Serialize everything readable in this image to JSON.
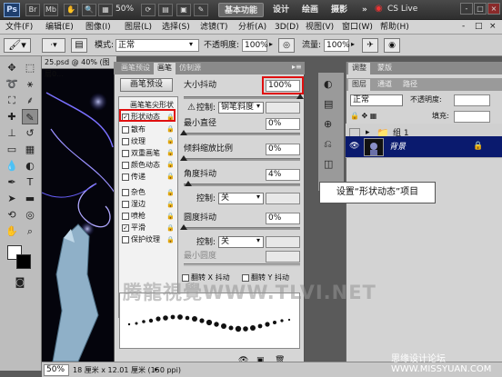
{
  "topbar": {
    "logo": "Ps",
    "zoom": "50%",
    "workspaces": [
      "基本功能",
      "设计",
      "绘画",
      "摄影"
    ],
    "more": "»",
    "cslive": "CS Live",
    "win_controls": [
      "-",
      "□",
      "×"
    ]
  },
  "menubar": {
    "items": [
      "文件(F)",
      "编辑(E)",
      "图像(I)",
      "图层(L)",
      "选择(S)",
      "滤镜(T)",
      "分析(A)",
      "3D(D)",
      "视图(V)",
      "窗口(W)",
      "帮助(H)"
    ],
    "win_controls": [
      "-",
      "□",
      "×"
    ]
  },
  "options_bar": {
    "mode_label": "模式:",
    "mode_value": "正常",
    "opacity_label": "不透明度:",
    "opacity_value": "100%",
    "flow_label": "流量:",
    "flow_value": "100%"
  },
  "document": {
    "tab_title": "25.psd @ 40% (图层0..."
  },
  "brush_panel": {
    "tabs": [
      "画笔预设",
      "画笔",
      "仿制源"
    ],
    "preset_button": "画笔预设",
    "options": [
      {
        "label": "画笔笔尖形状",
        "checked": null
      },
      {
        "label": "形状动态",
        "checked": true
      },
      {
        "label": "散布",
        "checked": false
      },
      {
        "label": "纹理",
        "checked": false
      },
      {
        "label": "双重画笔",
        "checked": false
      },
      {
        "label": "颜色动态",
        "checked": false
      },
      {
        "label": "传递",
        "checked": false
      },
      {
        "label": "杂色",
        "checked": false
      },
      {
        "label": "湿边",
        "checked": false
      },
      {
        "label": "喷枪",
        "checked": false
      },
      {
        "label": "平滑",
        "checked": true
      },
      {
        "label": "保护纹理",
        "checked": false
      }
    ],
    "size_jitter_label": "大小抖动",
    "size_jitter_value": "100%",
    "control_label": "控制:",
    "control1_value": "钢笔斜度",
    "min_diameter_label": "最小直径",
    "min_diameter_value": "0%",
    "tilt_scale_label": "倾斜缩放比例",
    "tilt_scale_value": "0%",
    "angle_jitter_label": "角度抖动",
    "angle_jitter_value": "4%",
    "control2_value": "关",
    "roundness_jitter_label": "圆度抖动",
    "roundness_jitter_value": "0%",
    "control3_value": "关",
    "min_roundness_label": "最小圆度",
    "flip_x_label": "翻转 X 抖动",
    "flip_y_label": "翻转 Y 抖动"
  },
  "layers_panel": {
    "top_tabs": [
      "调整",
      "蒙版"
    ],
    "tabs": [
      "图层",
      "通道",
      "路径"
    ],
    "blend_mode": "正常",
    "opacity_label": "不透明度:",
    "fill_label": "填充:",
    "layers": [
      {
        "name": "组 1",
        "type": "group"
      },
      {
        "name": "背景",
        "type": "layer",
        "selected": true
      }
    ]
  },
  "status_bar": {
    "zoom": "50%",
    "info": "18 厘米 x 12.01 厘米 (150 ppi)"
  },
  "callout": "设置“形状动态”项目",
  "watermark": "腾龍視覺WWW.TLVI.NET",
  "site_watermark": "思缘设计论坛 WWW.MISSYUAN.COM",
  "colors": {
    "highlight_red": "#e01010",
    "layer_selected": "#0a1a6e",
    "topbar": "#3a3a3a"
  }
}
